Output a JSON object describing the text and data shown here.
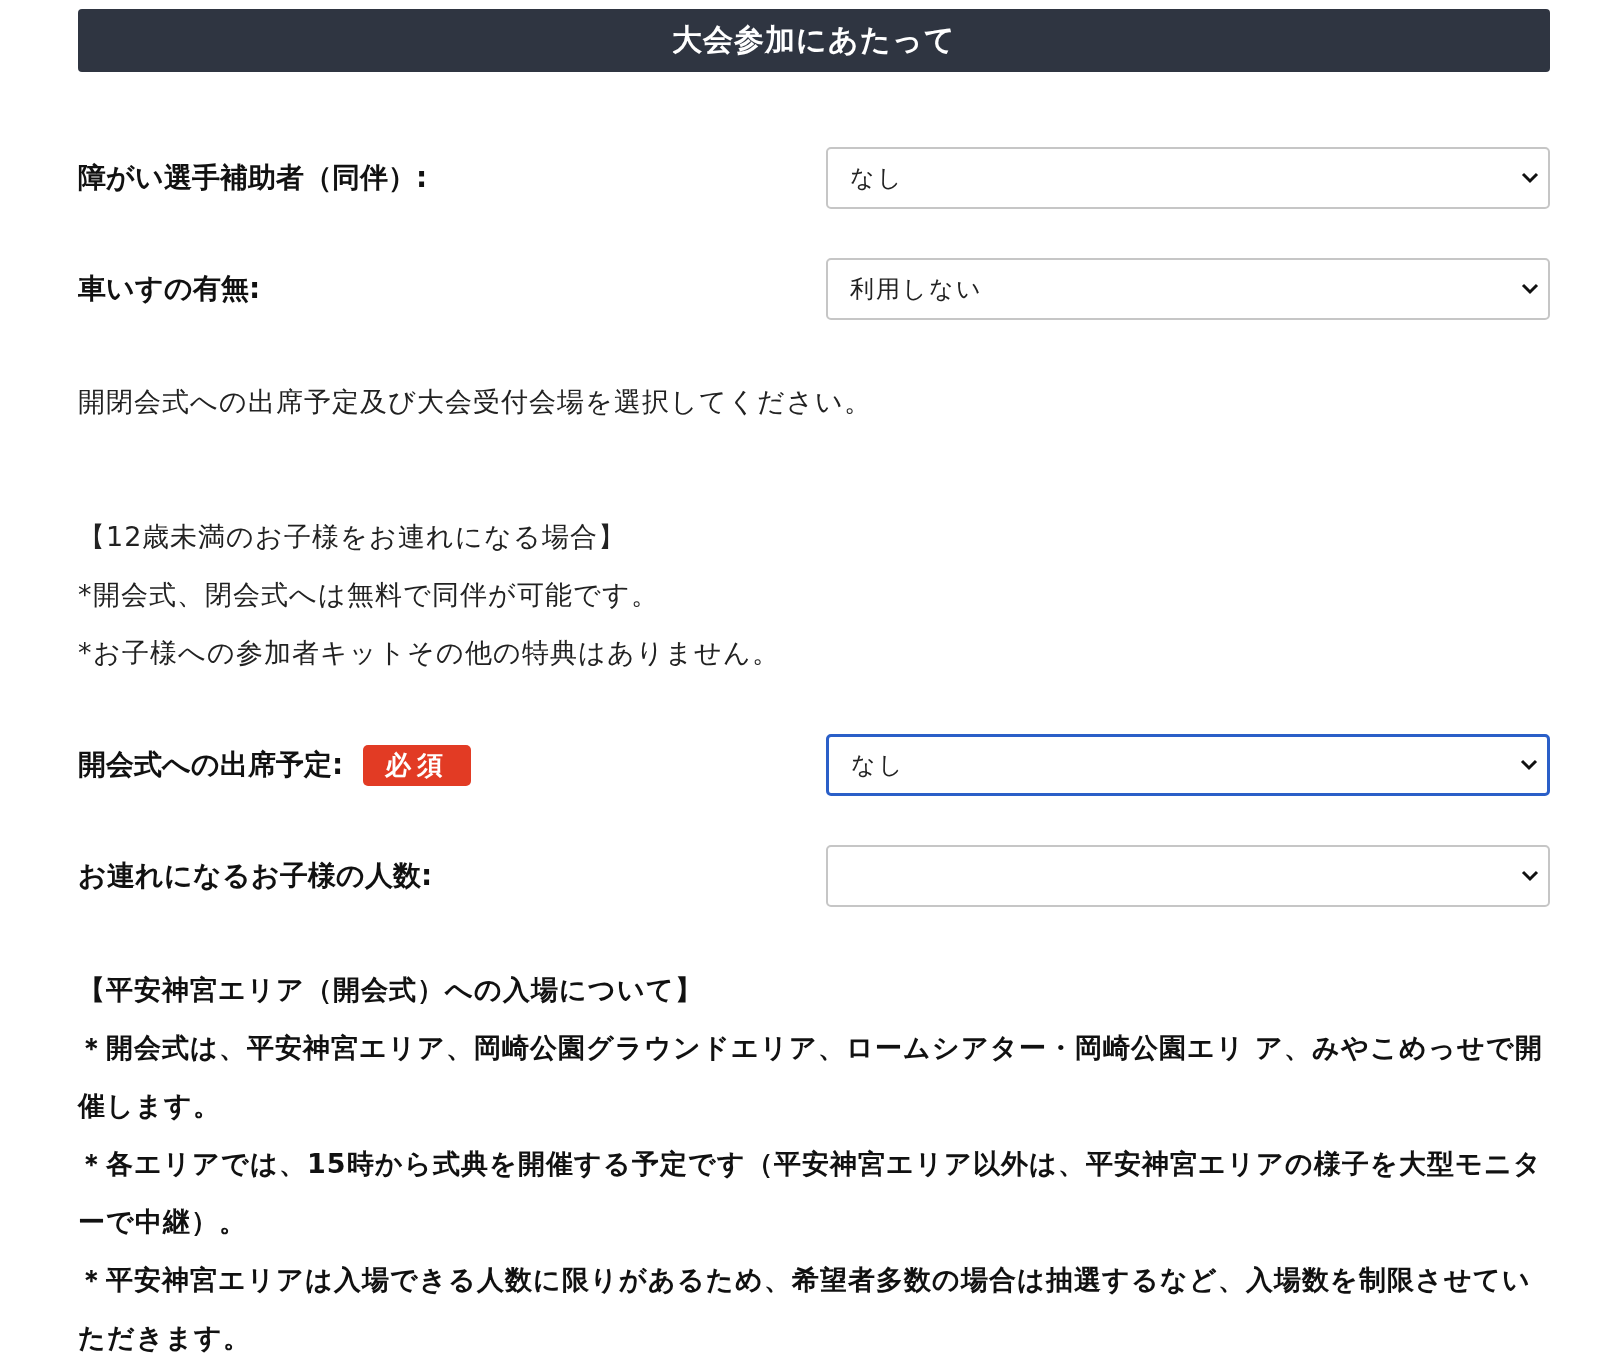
{
  "header": {
    "title": "大会参加にあたって"
  },
  "fields_top": [
    {
      "label": "障がい選手補助者（同伴）:",
      "value": "なし",
      "focused": false
    },
    {
      "label": "車いすの有無:",
      "value": "利用しない",
      "focused": false
    }
  ],
  "instruction": "開閉会式への出席予定及び大会受付会場を選択してください。",
  "children_note": {
    "heading": "【12歳未満のお子様をお連れになる場合】",
    "lines": [
      "*開会式、閉会式へは無料で同伴が可能です。",
      "*お子様への参加者キットその他の特典はありません。"
    ]
  },
  "fields_bottom": [
    {
      "label": "開会式への出席予定:",
      "required_badge": "必須",
      "value": "なし",
      "focused": true
    },
    {
      "label": "お連れになるお子様の人数:",
      "focused": false
    }
  ],
  "entry_note": {
    "heading": "【平安神宮エリア（開会式）への入場について】",
    "lines": [
      "＊開会式は、平安神宮エリア、岡崎公園グラウンドエリア、ロームシアター・岡崎公園エリ ア、みやこめっせで開催します。",
      "＊各エリアでは、15時から式典を開催する予定です（平安神宮エリア以外は、平安神宮エリアの様子を大型モニターで中継）。",
      "＊平安神宮エリアは入場できる人数に限りがあるため、希望者多数の場合は抽選するなど、入場数を制限させていただきます。"
    ]
  }
}
